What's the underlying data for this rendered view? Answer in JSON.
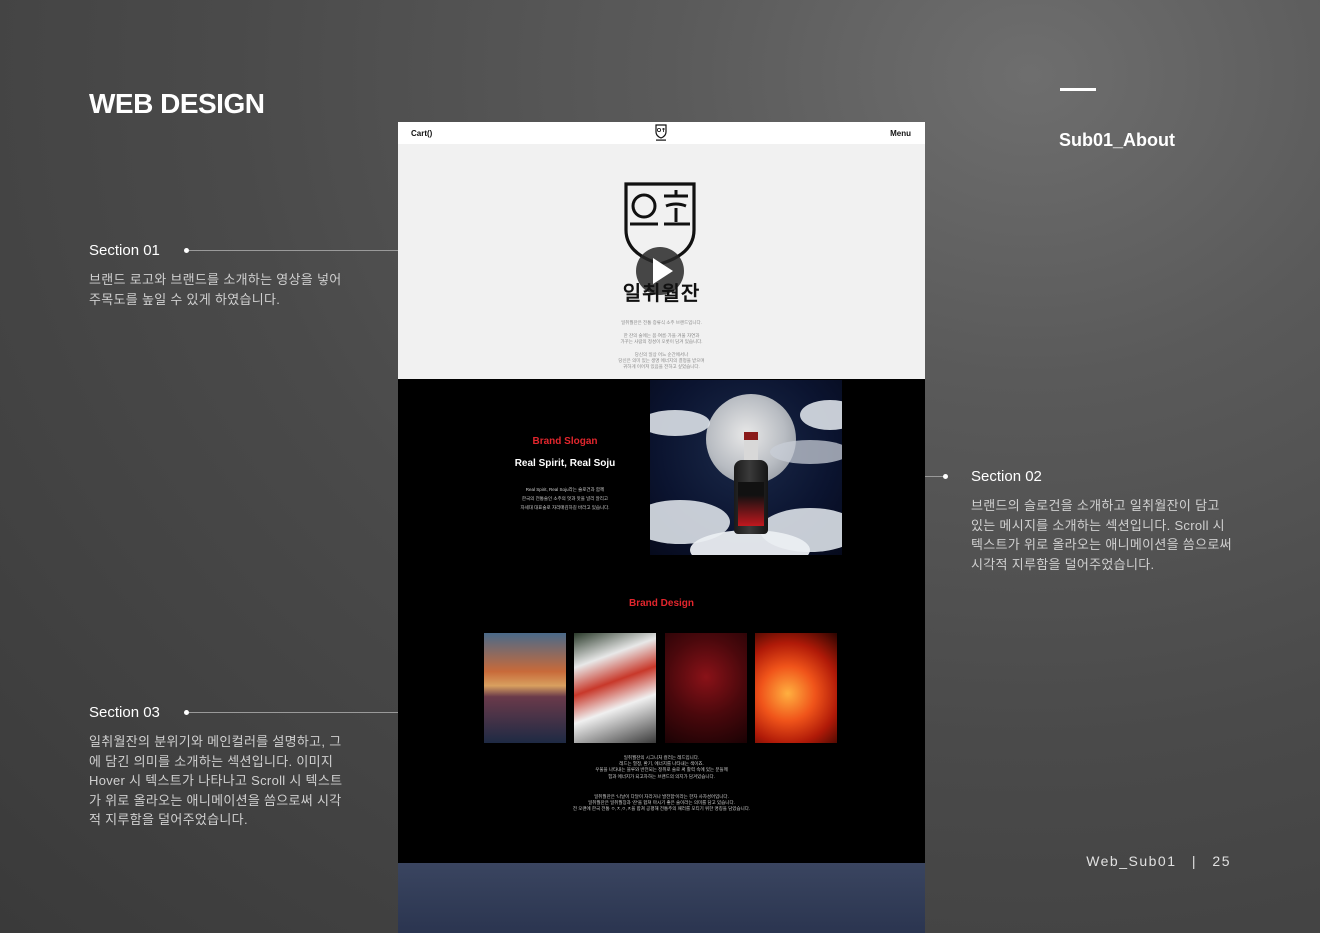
{
  "header": {
    "title": "WEB DESIGN",
    "subtitle": "Sub01_About"
  },
  "sections": [
    {
      "title": "Section 01",
      "desc": [
        "브랜드 로고와 브랜드를 소개하는 영상을 넣어",
        "주목도를 높일 수 있게 하였습니다."
      ]
    },
    {
      "title": "Section 02",
      "desc": [
        "브랜드의 슬로건을 소개하고 일취월잔이 담고",
        "있는 메시지를 소개하는 섹션입니다. Scroll 시",
        "텍스트가 위로 올라오는 애니메이션을 씀으로써",
        "시각적 지루함을 덜어주었습니다."
      ]
    },
    {
      "title": "Section 03",
      "desc": [
        "일취월잔의 분위기와 메인컬러를 설명하고, 그",
        "에 담긴 의미를 소개하는 섹션입니다. 이미지",
        "Hover 시 텍스트가 나타나고 Scroll 시 텍스트",
        "가 위로 올라오는 애니메이션을 씀으로써 시각",
        "적 지루함을 덜어주었습니다."
      ]
    }
  ],
  "footer": {
    "page_label": "Web_Sub01",
    "separator": "|",
    "page_number": "25"
  },
  "mockup": {
    "nav": {
      "cart": "Cart()",
      "menu": "Menu"
    },
    "hero": {
      "brand_name": "일취월잔",
      "text_lines": [
        "일취월잔은 전통 증류식 소주 브랜드입니다.",
        "한 잔의 술에는 봄·여름·가을·겨울 자연과",
        "가꾸는 사람의 정성이 오롯이 담겨 있습니다.",
        "당신의 일상 어느 순간에서나",
        "당신은 의미 있는 생명 에너지의 결정을 받으며",
        "귀하게 이어져 있음을 전하고 싶었습니다."
      ]
    },
    "slogan": {
      "label": "Brand Slogan",
      "headline": "Real Spirit, Real Soju",
      "body_lines": [
        "Real Spirit, Real Soju라는 슬로건과 함께",
        "한국의 전통술인 소주의 멋과 맛을 널리 알리고",
        "자세대 대표술로 자리매김하길 바라고 있습니다."
      ]
    },
    "design": {
      "label": "Brand Design",
      "body_lines_1": [
        "일취월잔의 시그니처 컬러는 레드입니다.",
        "레드는 열정, 환기, 에너지를 나타내는 색이죠.",
        "우울을 나타내는 블루와 반전되는 정취로 술로 써 활력 속에 있는 분들께",
        "힘과 에너지가 되고자하는 브랜드의 의지가 담겨있습니다."
      ],
      "body_lines_2": [
        "일취월잔은 '나날이 다달이 자라거나 발전함'이라는 한자 사자성어입니다.",
        "일취월잔은 일취월장과 '잔'을 합쳐 마시기 좋은 술이라는 의미를 담고 있습니다.",
        "전 오랜에 한국 전통 ㅇ,ㅊ,ㅇ,ㅈ을 합쳐 공평해 전통주의 패러를 모티기 위한 명칭을 담았습니다."
      ]
    }
  },
  "colors": {
    "accent_red": "#e3262d",
    "mock_black": "#000000",
    "hero_bg": "#f1f1f1"
  }
}
